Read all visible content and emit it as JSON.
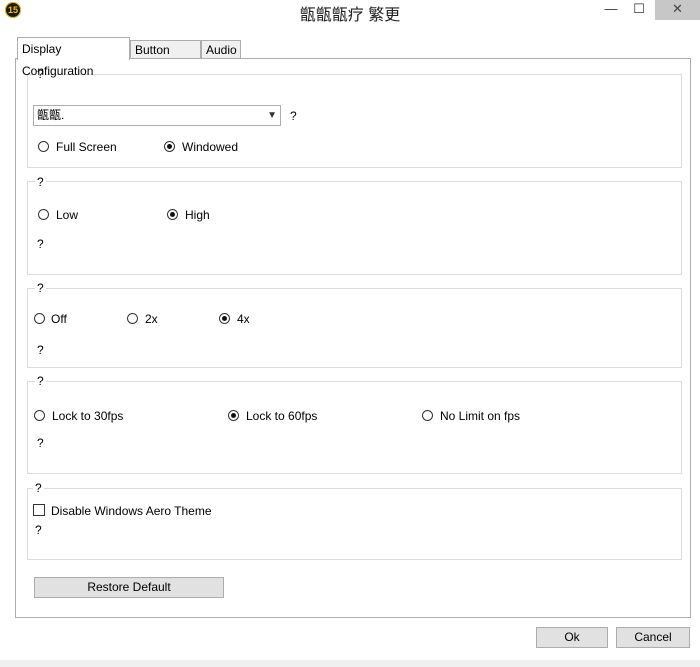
{
  "window": {
    "title": "甑甑甑疗 繁更",
    "app_icon_text": "15",
    "minimize_glyph": "—",
    "maximize_glyph": "☐",
    "close_glyph": "✕"
  },
  "tabs": [
    {
      "label": "Display Configuration",
      "active": true
    },
    {
      "label": "Button Icons",
      "active": false
    },
    {
      "label": "Audio",
      "active": false
    }
  ],
  "display_mode": {
    "legend": "?",
    "resolution_value": "甑甑.",
    "resolution_hint": "?",
    "options": [
      {
        "label": "Full Screen",
        "selected": false
      },
      {
        "label": "Windowed",
        "selected": true
      }
    ]
  },
  "quality": {
    "legend": "?",
    "options": [
      {
        "label": "Low",
        "selected": false
      },
      {
        "label": "High",
        "selected": true
      }
    ],
    "note": "?"
  },
  "antialias": {
    "legend": "?",
    "options": [
      {
        "label": "Off",
        "selected": false
      },
      {
        "label": "2x",
        "selected": false
      },
      {
        "label": "4x",
        "selected": true
      }
    ],
    "note": "?"
  },
  "framerate": {
    "legend": "?",
    "options": [
      {
        "label": "Lock  to 30fps",
        "selected": false
      },
      {
        "label": "Lock to 60fps",
        "selected": true
      },
      {
        "label": "No Limit on fps",
        "selected": false
      }
    ],
    "note": "?"
  },
  "aero": {
    "legend": "?",
    "checkbox_label": "Disable Windows Aero Theme",
    "checked": false,
    "note": "?"
  },
  "buttons": {
    "restore_default": "Restore Default",
    "ok": "Ok",
    "cancel": "Cancel"
  }
}
